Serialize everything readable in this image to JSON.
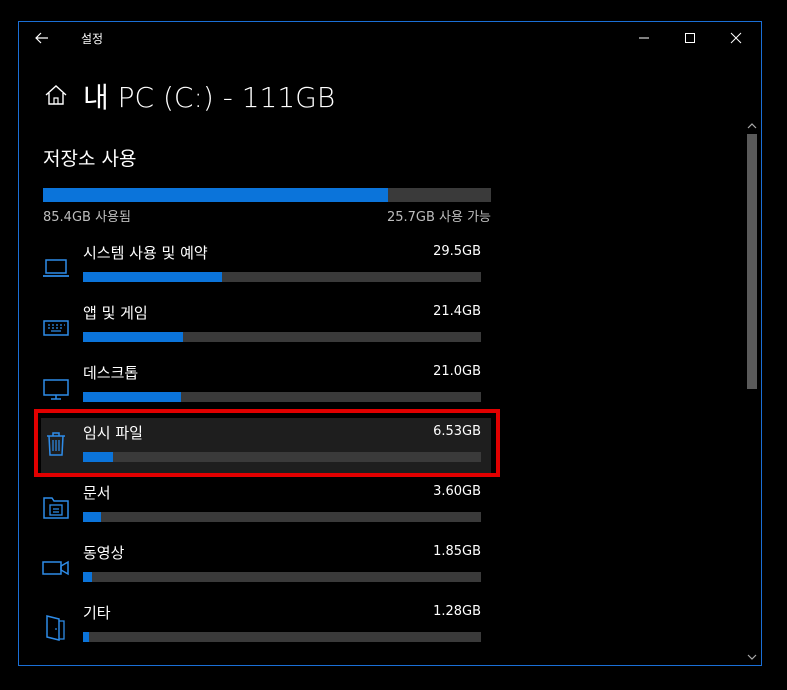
{
  "window": {
    "title": "설정"
  },
  "header": {
    "title": "내 PC (C:) - 111GB"
  },
  "storage": {
    "section_title": "저장소 사용",
    "used_label": "85.4GB 사용됨",
    "free_label": "25.7GB 사용 가능",
    "used_fraction": 0.769
  },
  "categories": [
    {
      "name": "시스템 사용 및 예약",
      "size": "29.5GB",
      "fraction": 0.35,
      "icon": "laptop-icon"
    },
    {
      "name": "앱 및 게임",
      "size": "21.4GB",
      "fraction": 0.25,
      "icon": "keyboard-icon"
    },
    {
      "name": "데스크톱",
      "size": "21.0GB",
      "fraction": 0.245,
      "icon": "monitor-icon"
    },
    {
      "name": "임시 파일",
      "size": "6.53GB",
      "fraction": 0.075,
      "icon": "trash-icon",
      "highlighted": true
    },
    {
      "name": "문서",
      "size": "3.60GB",
      "fraction": 0.045,
      "icon": "documents-icon"
    },
    {
      "name": "동영상",
      "size": "1.85GB",
      "fraction": 0.022,
      "icon": "video-camera-icon"
    },
    {
      "name": "기타",
      "size": "1.28GB",
      "fraction": 0.015,
      "icon": "other-files-icon"
    }
  ],
  "colors": {
    "accent": "#0b74da",
    "track": "#3a3a3a",
    "highlight": "#e10000",
    "border": "#1a6fd6"
  }
}
